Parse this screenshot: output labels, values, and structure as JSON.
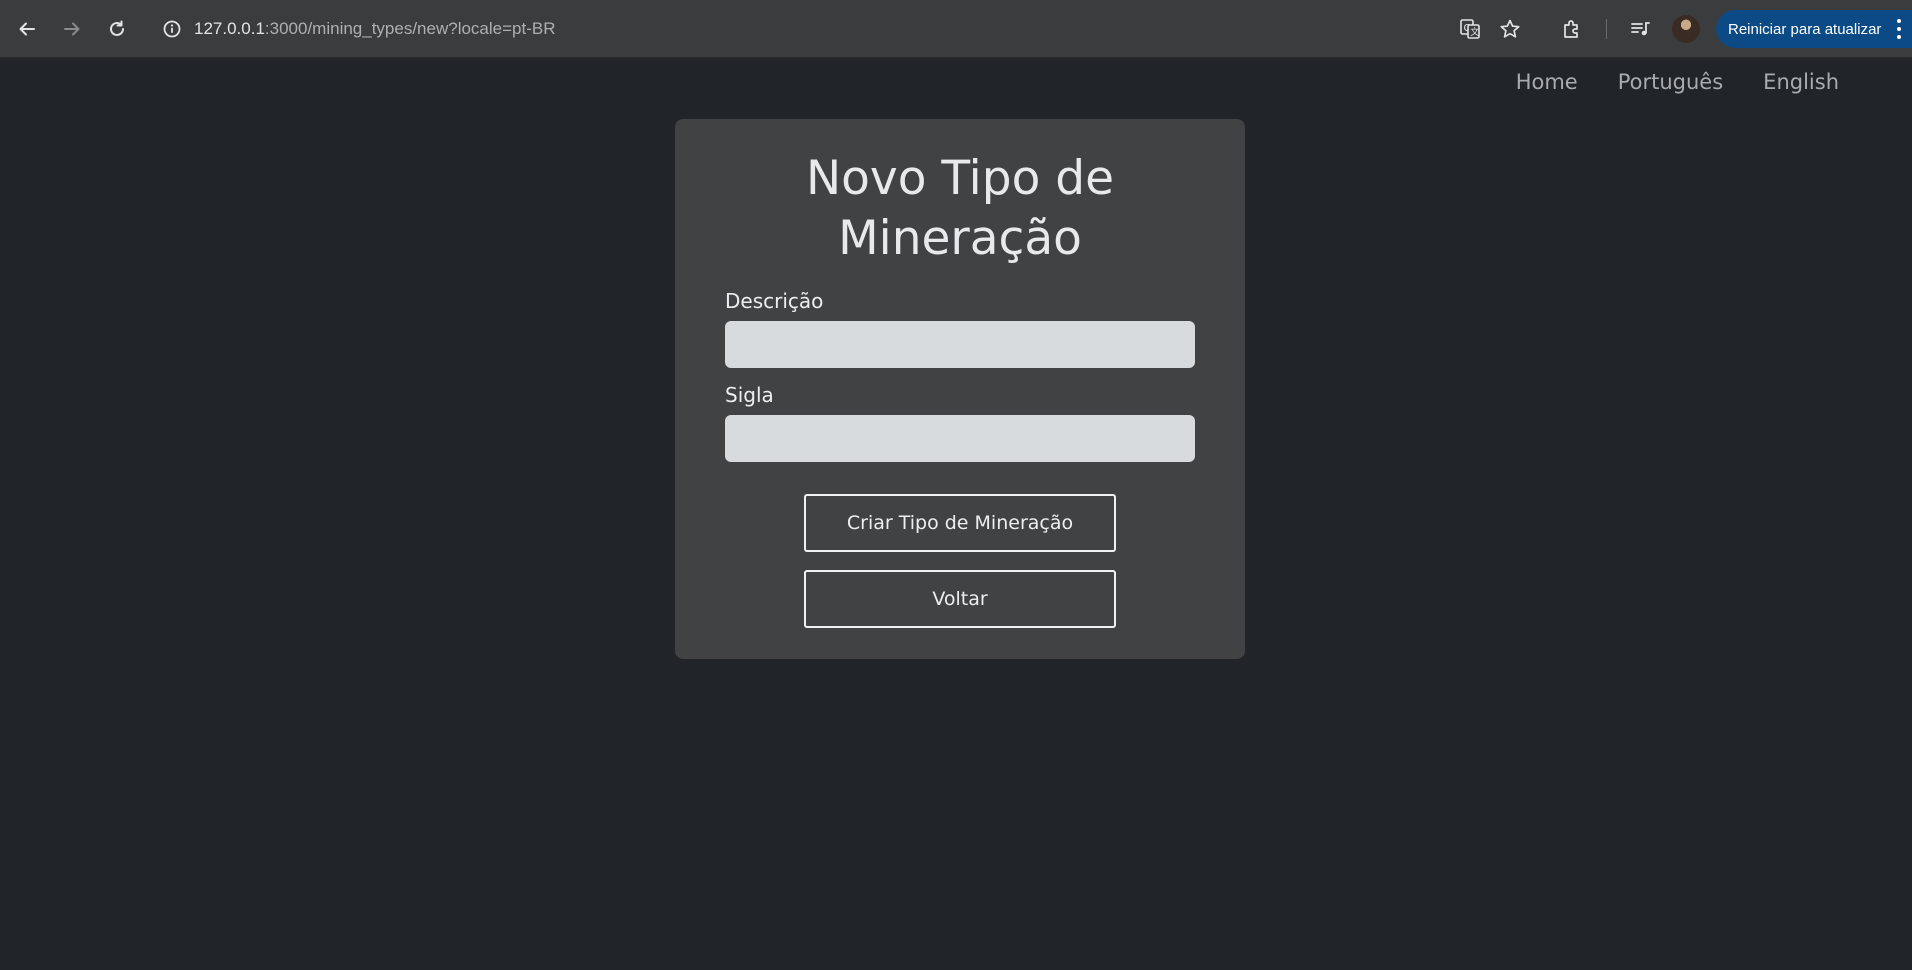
{
  "browser": {
    "url_host": "127.0.0.1",
    "url_rest": ":3000/mining_types/new?locale=pt-BR",
    "update_button_label": "Reiniciar para atualizar",
    "update_button_color": "#0b4a84"
  },
  "icons": {
    "back": "back-arrow-icon",
    "forward": "forward-arrow-icon",
    "reload": "reload-icon",
    "site_info": "info-icon",
    "translate": "translate-icon",
    "bookmark": "star-icon",
    "extensions": "puzzle-icon",
    "media": "media-queue-icon",
    "menu": "kebab-menu-icon"
  },
  "nav": {
    "links": [
      {
        "label": "Home"
      },
      {
        "label": "Português"
      },
      {
        "label": "English"
      }
    ]
  },
  "form": {
    "title": "Novo Tipo de Mineração",
    "fields": [
      {
        "label": "Descrição",
        "value": "",
        "placeholder": ""
      },
      {
        "label": "Sigla",
        "value": "",
        "placeholder": ""
      }
    ],
    "submit_label": "Criar Tipo de Mineração",
    "back_label": "Voltar"
  },
  "colors": {
    "page_background": "#212428",
    "card_background": "#414244",
    "input_background": "#d8dbdd"
  }
}
